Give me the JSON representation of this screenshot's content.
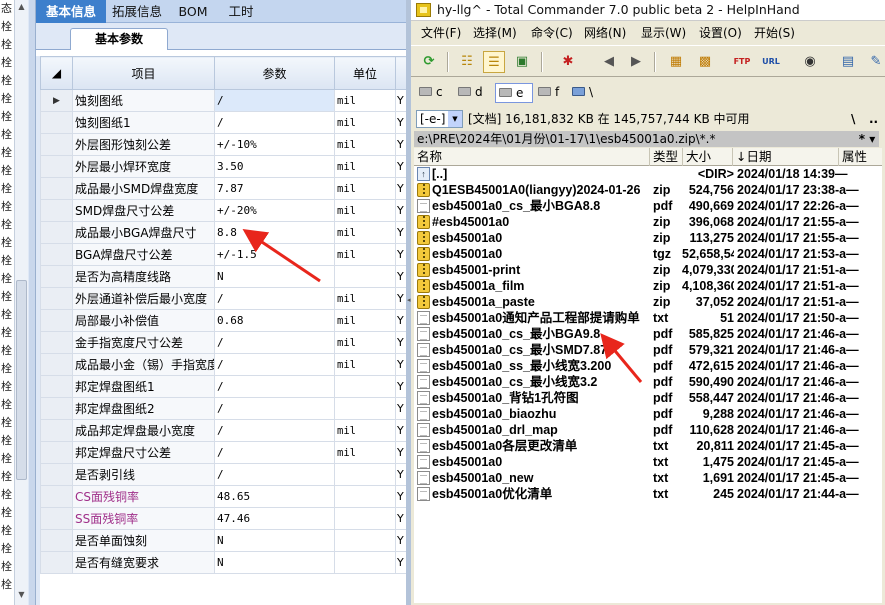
{
  "left_strip": {
    "chars": [
      "态",
      "栓",
      "栓",
      "栓",
      "栓",
      "栓",
      "栓",
      "栓",
      "栓",
      "栓",
      "栓",
      "栓",
      "栓",
      "栓",
      "栓",
      "栓",
      "栓",
      "栓",
      "栓",
      "栓",
      "栓",
      "栓",
      "栓",
      "栓",
      "栓",
      "栓",
      "栓",
      "栓",
      "栓",
      "栓",
      "栓",
      "栓",
      "栓"
    ]
  },
  "left_panel": {
    "tabs": [
      "基本信息",
      "拓展信息",
      "BOM",
      "工时"
    ],
    "subtab": "基本参数",
    "columns": {
      "item": "项目",
      "param": "参数",
      "unit": "单位",
      "extra": ""
    },
    "rows": [
      {
        "name": "蚀刻图纸",
        "value": "/",
        "unit": "mil",
        "extra": "Y",
        "highlight": false
      },
      {
        "name": "蚀刻图纸1",
        "value": "/",
        "unit": "mil",
        "extra": "Y",
        "highlight": false
      },
      {
        "name": "外层图形蚀刻公差",
        "value": "+/-10%",
        "unit": "mil",
        "extra": "Y",
        "highlight": false
      },
      {
        "name": "外层最小焊环宽度",
        "value": "3.50",
        "unit": "mil",
        "extra": "Y",
        "highlight": false
      },
      {
        "name": "成品最小SMD焊盘宽度",
        "value": "7.87",
        "unit": "mil",
        "extra": "Y",
        "highlight": false
      },
      {
        "name": "SMD焊盘尺寸公差",
        "value": "+/-20%",
        "unit": "mil",
        "extra": "Y",
        "highlight": false
      },
      {
        "name": "成品最小BGA焊盘尺寸",
        "value": "8.8",
        "unit": "mil",
        "extra": "Y",
        "highlight": false
      },
      {
        "name": "BGA焊盘尺寸公差",
        "value": "+/-1.5",
        "unit": "mil",
        "extra": "Y",
        "highlight": false
      },
      {
        "name": "是否为高精度线路",
        "value": "N",
        "unit": "",
        "extra": "Y",
        "highlight": false
      },
      {
        "name": "外层通道补偿后最小宽度",
        "value": "/",
        "unit": "mil",
        "extra": "Y",
        "highlight": false
      },
      {
        "name": "局部最小补偿值",
        "value": "0.68",
        "unit": "mil",
        "extra": "Y",
        "highlight": false
      },
      {
        "name": "金手指宽度尺寸公差",
        "value": "/",
        "unit": "mil",
        "extra": "Y",
        "highlight": false
      },
      {
        "name": "成品最小金（锡）手指宽度",
        "value": "/",
        "unit": "mil",
        "extra": "Y",
        "highlight": false
      },
      {
        "name": "邦定焊盘图纸1",
        "value": "/",
        "unit": "",
        "extra": "Y",
        "highlight": false
      },
      {
        "name": "邦定焊盘图纸2",
        "value": "/",
        "unit": "",
        "extra": "Y",
        "highlight": false
      },
      {
        "name": "成品邦定焊盘最小宽度",
        "value": "/",
        "unit": "mil",
        "extra": "Y",
        "highlight": false
      },
      {
        "name": "邦定焊盘尺寸公差",
        "value": "/",
        "unit": "mil",
        "extra": "Y",
        "highlight": false
      },
      {
        "name": "是否剥引线",
        "value": "/",
        "unit": "",
        "extra": "Y",
        "highlight": false
      },
      {
        "name": "CS面残铜率",
        "value": "48.65",
        "unit": "",
        "extra": "Y",
        "highlight": true
      },
      {
        "name": "SS面残铜率",
        "value": "47.46",
        "unit": "",
        "extra": "Y",
        "highlight": true
      },
      {
        "name": "是否单面蚀刻",
        "value": "N",
        "unit": "",
        "extra": "Y",
        "highlight": false
      },
      {
        "name": "是否有缝宽要求",
        "value": "N",
        "unit": "",
        "extra": "Y",
        "highlight": false
      }
    ]
  },
  "tc": {
    "title": "hy-llg^ - Total Commander 7.0 public beta 2 - HelpInHand",
    "menu": [
      "文件(F)",
      "选择(M)",
      "命令(C)",
      "网络(N)",
      "显示(W)",
      "设置(O)",
      "开始(S)"
    ],
    "toolbar_icons": [
      "refresh-icon",
      "brief-view-icon",
      "detailed-view-icon",
      "thumbnail-view-icon",
      "invert-selection-icon",
      "back-icon",
      "forward-icon",
      "pack-icon",
      "unpack-icon",
      "ftp-connect-icon",
      "url-connect-icon",
      "find-icon",
      "view-file-icon",
      "edit-file-icon"
    ],
    "drives": [
      "c",
      "d",
      "e",
      "f",
      "\\"
    ],
    "drive_selector": "[-e-]",
    "info_text": "[文档]  16,181,832 KB 在 145,757,744 KB 中可用",
    "info_btn1": "\\",
    "info_btn2": "..",
    "path": "e:\\PRE\\2024年\\01月份\\01-17\\1\\esb45001a0.zip\\*.*",
    "path_btn": "* ▾",
    "headers": {
      "name": "名称",
      "ext": "类型",
      "size": "大小",
      "date": "↓日期",
      "attr": "属性"
    },
    "files": [
      {
        "icon": "up",
        "name": "[..]",
        "ext": "",
        "size": "<DIR>",
        "date": "2024/01/18 14:39—"
      },
      {
        "icon": "zip",
        "name": "Q1ESB45001A0(liangyy)2024-01-26",
        "ext": "zip",
        "size": "524,756",
        "date": "2024/01/17 23:38-a—"
      },
      {
        "icon": "doc",
        "name": "esb45001a0_cs_最小BGA8.8",
        "ext": "pdf",
        "size": "490,669",
        "date": "2024/01/17 22:26-a—"
      },
      {
        "icon": "zip",
        "name": "#esb45001a0",
        "ext": "zip",
        "size": "396,068",
        "date": "2024/01/17 21:55-a—"
      },
      {
        "icon": "zip",
        "name": "esb45001a0",
        "ext": "zip",
        "size": "113,275",
        "date": "2024/01/17 21:55-a—"
      },
      {
        "icon": "zip",
        "name": "esb45001a0",
        "ext": "tgz",
        "size": "52,658,544",
        "date": "2024/01/17 21:53-a—"
      },
      {
        "icon": "zip",
        "name": "esb45001-print",
        "ext": "zip",
        "size": "4,079,330",
        "date": "2024/01/17 21:51-a—"
      },
      {
        "icon": "zip",
        "name": "esb45001a_film",
        "ext": "zip",
        "size": "4,108,360",
        "date": "2024/01/17 21:51-a—"
      },
      {
        "icon": "zip",
        "name": "esb45001a_paste",
        "ext": "zip",
        "size": "37,052",
        "date": "2024/01/17 21:51-a—"
      },
      {
        "icon": "doc",
        "name": "esb45001a0通知产品工程部提请购单",
        "ext": "txt",
        "size": "51",
        "date": "2024/01/17 21:50-a—"
      },
      {
        "icon": "doc",
        "name": "esb45001a0_cs_最小BGA9.8",
        "ext": "pdf",
        "size": "585,825",
        "date": "2024/01/17 21:46-a—"
      },
      {
        "icon": "doc",
        "name": "esb45001a0_cs_最小SMD7.87",
        "ext": "pdf",
        "size": "579,321",
        "date": "2024/01/17 21:46-a—"
      },
      {
        "icon": "doc",
        "name": "esb45001a0_ss_最小线宽3.200",
        "ext": "pdf",
        "size": "472,615",
        "date": "2024/01/17 21:46-a—"
      },
      {
        "icon": "doc",
        "name": "esb45001a0_cs_最小线宽3.2",
        "ext": "pdf",
        "size": "590,490",
        "date": "2024/01/17 21:46-a—"
      },
      {
        "icon": "doc",
        "name": "esb45001a0_背钻1孔符图",
        "ext": "pdf",
        "size": "558,447",
        "date": "2024/01/17 21:46-a—"
      },
      {
        "icon": "doc",
        "name": "esb45001a0_biaozhu",
        "ext": "pdf",
        "size": "9,288",
        "date": "2024/01/17 21:46-a—"
      },
      {
        "icon": "doc",
        "name": "esb45001a0_drl_map",
        "ext": "pdf",
        "size": "110,628",
        "date": "2024/01/17 21:46-a—"
      },
      {
        "icon": "doc",
        "name": "esb45001a0各层更改清单",
        "ext": "txt",
        "size": "20,811",
        "date": "2024/01/17 21:45-a—"
      },
      {
        "icon": "doc",
        "name": "esb45001a0",
        "ext": "txt",
        "size": "1,475",
        "date": "2024/01/17 21:45-a—"
      },
      {
        "icon": "doc",
        "name": "esb45001a0_new",
        "ext": "txt",
        "size": "1,691",
        "date": "2024/01/17 21:45-a—"
      },
      {
        "icon": "doc",
        "name": "esb45001a0优化清单",
        "ext": "txt",
        "size": "245",
        "date": "2024/01/17 21:44-a—"
      }
    ]
  },
  "colors": {
    "tab_active": "#3d7fcc",
    "panel_bg": "#dfe8f6",
    "highlight_text": "#a0308a",
    "arrow": "#e8261c"
  }
}
